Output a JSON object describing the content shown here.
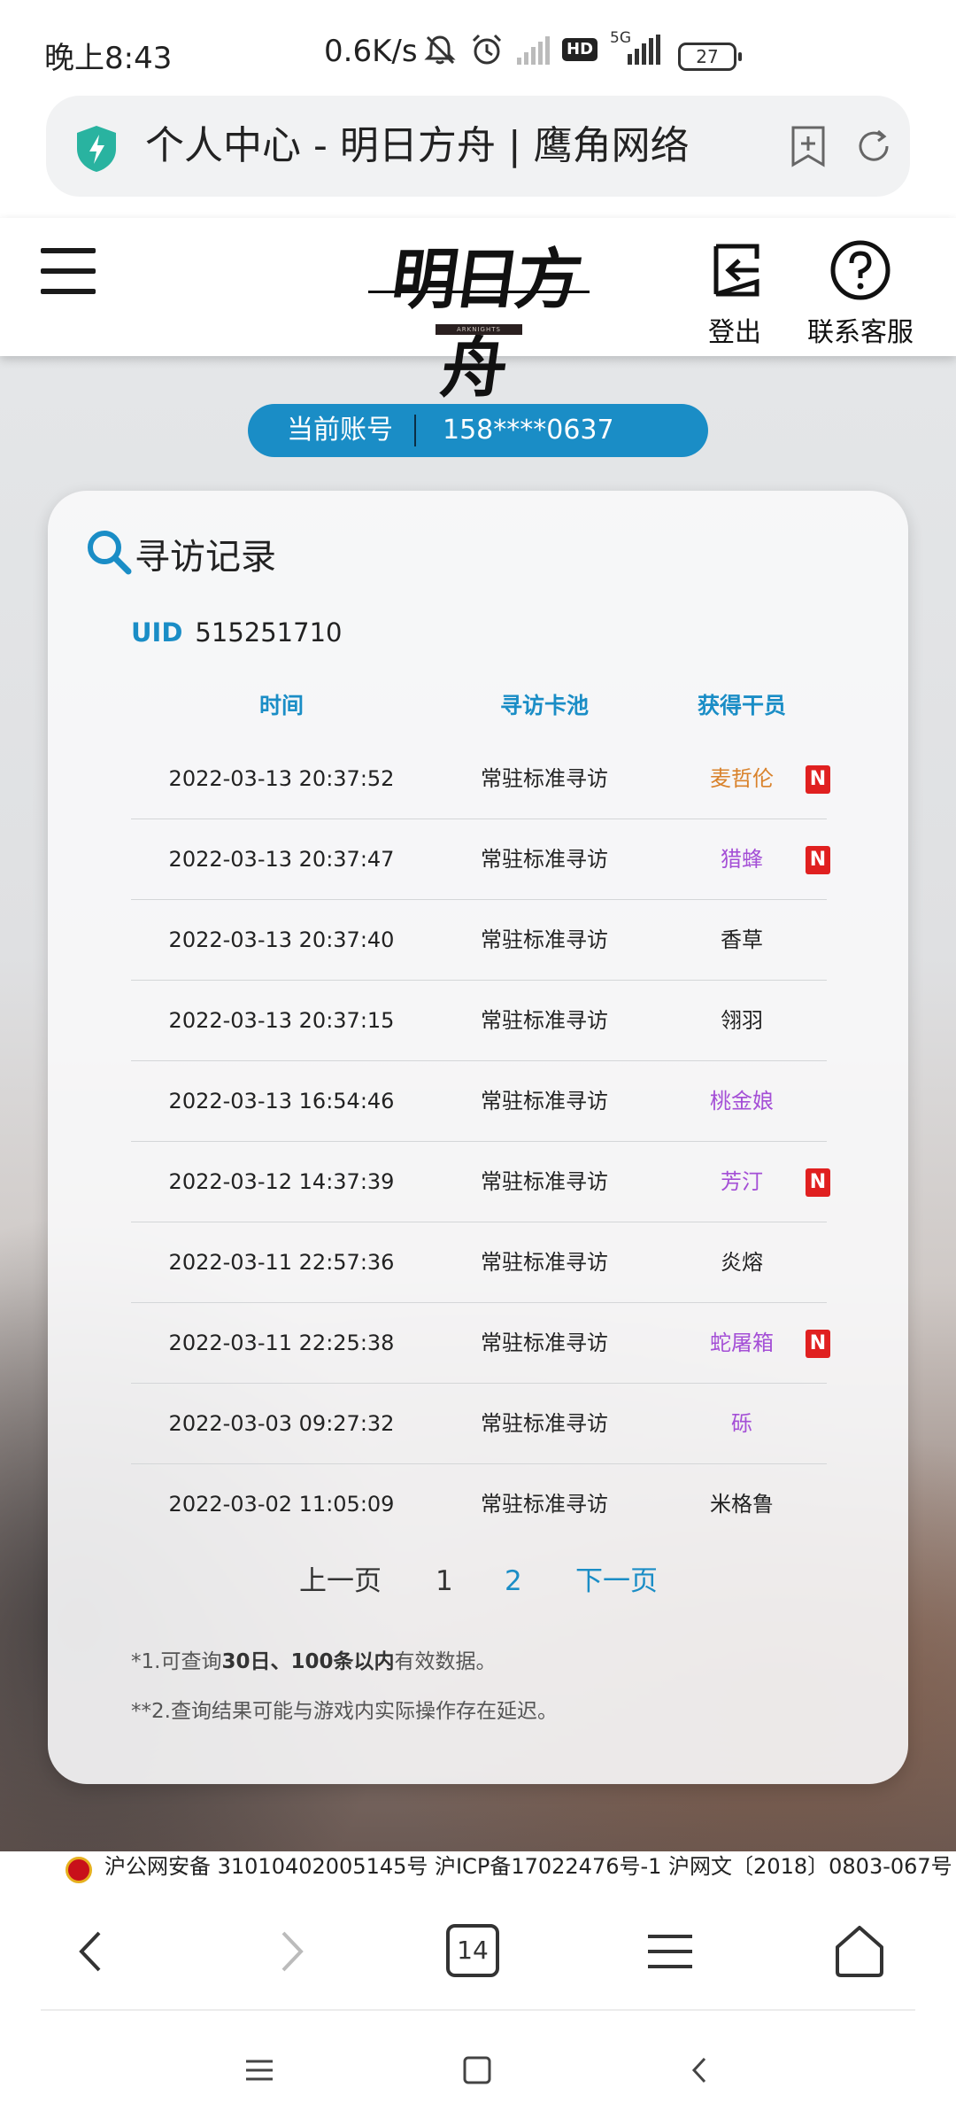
{
  "status_bar": {
    "time": "晚上8:43",
    "net_speed": "0.6K/s",
    "network_label": "5G",
    "hd_badge": "HD",
    "battery": "27"
  },
  "url_bar": {
    "title": "个人中心 - 明日方舟 | 鹰角网络",
    "icons": [
      "shield-icon",
      "add-bookmark-icon",
      "refresh-icon"
    ]
  },
  "site_header": {
    "logo_text": "明日方舟",
    "logo_subtext": "ARKNIGHTS",
    "logout_label": "登出",
    "support_label": "联系客服"
  },
  "account": {
    "label": "当前账号",
    "value": "158****0637"
  },
  "card": {
    "title": "寻访记录",
    "uid_label": "UID",
    "uid_value": "515251710",
    "columns": [
      "时间",
      "寻访卡池",
      "获得干员"
    ],
    "rows": [
      {
        "time": "2022-03-13 20:37:52",
        "pool": "常驻标准寻访",
        "operator": "麦哲伦",
        "color": "#d9822b",
        "new": true
      },
      {
        "time": "2022-03-13 20:37:47",
        "pool": "常驻标准寻访",
        "operator": "猎蜂",
        "color": "#a44fd6",
        "new": true
      },
      {
        "time": "2022-03-13 20:37:40",
        "pool": "常驻标准寻访",
        "operator": "香草",
        "color": "#222222",
        "new": false
      },
      {
        "time": "2022-03-13 20:37:15",
        "pool": "常驻标准寻访",
        "operator": "翎羽",
        "color": "#222222",
        "new": false
      },
      {
        "time": "2022-03-13 16:54:46",
        "pool": "常驻标准寻访",
        "operator": "桃金娘",
        "color": "#a44fd6",
        "new": false
      },
      {
        "time": "2022-03-12 14:37:39",
        "pool": "常驻标准寻访",
        "operator": "芳汀",
        "color": "#a44fd6",
        "new": true
      },
      {
        "time": "2022-03-11 22:57:36",
        "pool": "常驻标准寻访",
        "operator": "炎熔",
        "color": "#222222",
        "new": false
      },
      {
        "time": "2022-03-11 22:25:38",
        "pool": "常驻标准寻访",
        "operator": "蛇屠箱",
        "color": "#a44fd6",
        "new": true
      },
      {
        "time": "2022-03-03 09:27:32",
        "pool": "常驻标准寻访",
        "operator": "砾",
        "color": "#a44fd6",
        "new": false
      },
      {
        "time": "2022-03-02 11:05:09",
        "pool": "常驻标准寻访",
        "operator": "米格鲁",
        "color": "#222222",
        "new": false
      }
    ],
    "new_badge": "N",
    "pagination": {
      "prev": "上一页",
      "page1": "1",
      "page2": "2",
      "next": "下一页"
    },
    "note1_prefix": "*1.可查询",
    "note1_bold": "30日、100条以内",
    "note1_suffix": "有效数据。",
    "note2": "**2.查询结果可能与游戏内实际操作存在延迟。"
  },
  "footer": {
    "text": "沪公网安备 31010402005145号  沪ICP备17022476号-1  沪网文〔2018〕0803-067号"
  },
  "browser_nav": {
    "tab_count": "14"
  },
  "colors": {
    "accent_blue": "#1a8dc6",
    "new_red": "#e02020",
    "six_star_orange": "#d9822b",
    "four_star_purple": "#a44fd6"
  }
}
